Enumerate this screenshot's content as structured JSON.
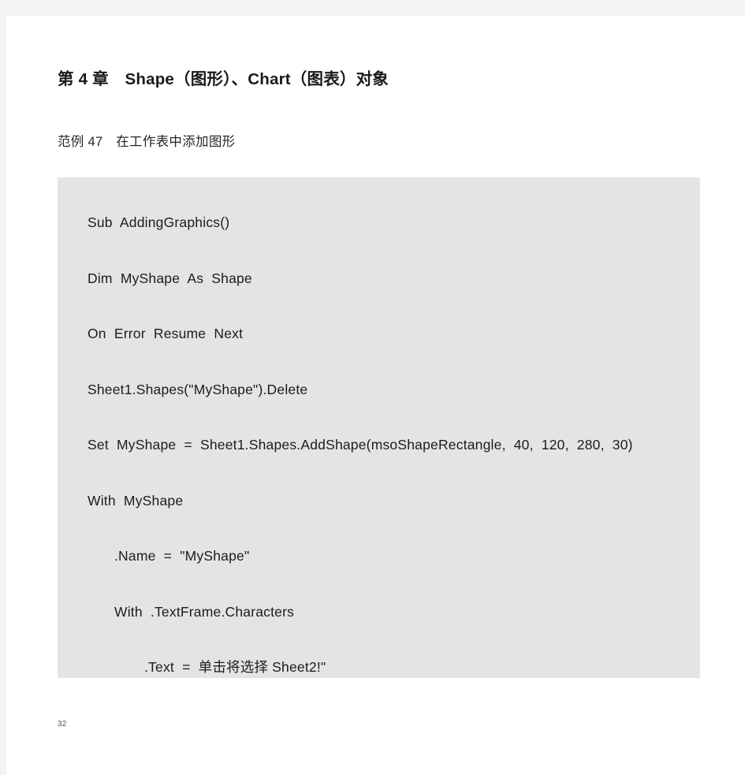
{
  "document": {
    "chapter_heading": "第 4 章　Shape（图形）、Chart（图表）对象",
    "example_subtitle": "范例 47　在工作表中添加图形",
    "page_number": "32",
    "colors": {
      "page_background": "#ffffff",
      "viewport_background": "#f4f4f4",
      "code_block_background": "#e4e4e4",
      "text": "#1a1a1a"
    }
  },
  "code_block": {
    "language": "vba",
    "lines": [
      {
        "text": "Sub  AddingGraphics()",
        "indent": 0
      },
      {
        "text": "Dim  MyShape  As  Shape",
        "indent": 0
      },
      {
        "text": "On  Error  Resume  Next",
        "indent": 0
      },
      {
        "text": "Sheet1.Shapes(\"MyShape\").Delete",
        "indent": 0
      },
      {
        "text": "Set  MyShape  =  Sheet1.Shapes.AddShape(msoShapeRectangle,  40,  120,  280,  30)",
        "indent": 0
      },
      {
        "text": "With  MyShape",
        "indent": 0
      },
      {
        "text": ".Name  =  \"MyShape\"",
        "indent": 1
      },
      {
        "text": "With  .TextFrame.Characters",
        "indent": 1
      },
      {
        "text": ".Text  =  单击将选择 Sheet2!\"",
        "indent": 2
      }
    ]
  }
}
